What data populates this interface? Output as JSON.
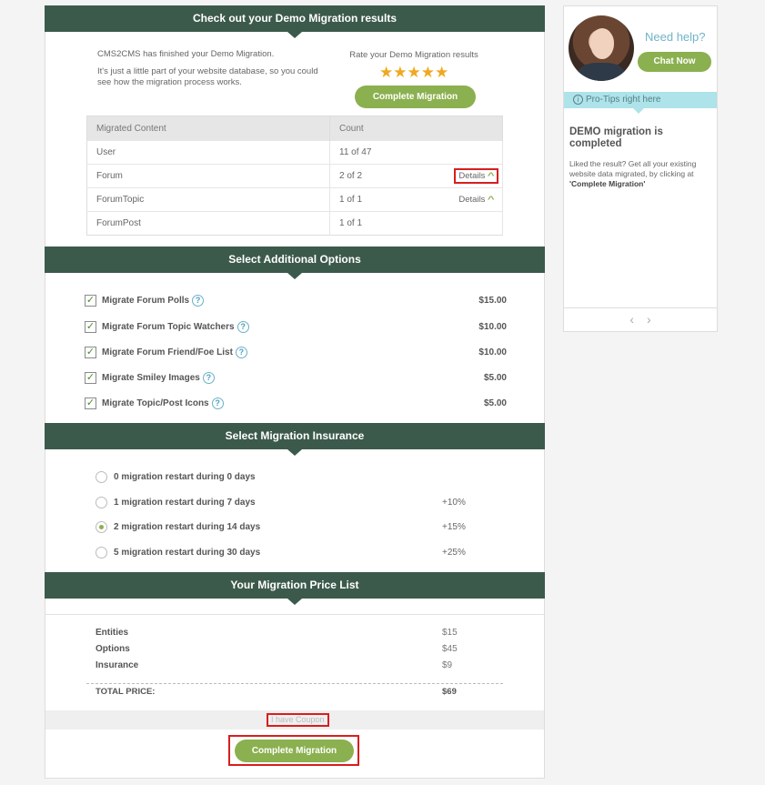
{
  "results": {
    "header": "Check out your Demo Migration results",
    "intro_line1": "CMS2CMS has finished your Demo Migration.",
    "intro_line2": "It's just a little part of your website database, so you could see how the migration process works.",
    "rate_label": "Rate your Demo Migration results",
    "stars": "★★★★★",
    "complete_button": "Complete Migration",
    "table": {
      "col_content": "Migrated Content",
      "col_count": "Count",
      "details_label": "Details",
      "rows": [
        {
          "content": "User",
          "count": "11 of 47"
        },
        {
          "content": "Forum",
          "count": "2 of 2"
        },
        {
          "content": "ForumTopic",
          "count": "1 of 1"
        },
        {
          "content": "ForumPost",
          "count": "1 of 1"
        }
      ]
    }
  },
  "options": {
    "header": "Select Additional Options",
    "items": [
      {
        "label": "Migrate Forum Polls",
        "price": "$15.00",
        "checked": true
      },
      {
        "label": "Migrate Forum Topic Watchers",
        "price": "$10.00",
        "checked": true
      },
      {
        "label": "Migrate Forum Friend/Foe List",
        "price": "$10.00",
        "checked": true
      },
      {
        "label": "Migrate Smiley Images",
        "price": "$5.00",
        "checked": true
      },
      {
        "label": "Migrate Topic/Post Icons",
        "price": "$5.00",
        "checked": true
      }
    ]
  },
  "insurance": {
    "header": "Select Migration Insurance",
    "items": [
      {
        "label": "0 migration restart during 0 days",
        "pct": "",
        "selected": false
      },
      {
        "label": "1 migration restart during 7 days",
        "pct": "+10%",
        "selected": false
      },
      {
        "label": "2 migration restart during 14 days",
        "pct": "+15%",
        "selected": true
      },
      {
        "label": "5 migration restart during 30 days",
        "pct": "+25%",
        "selected": false
      }
    ]
  },
  "price_list": {
    "header": "Your Migration Price List",
    "rows": [
      {
        "key": "Entities",
        "value": "$15"
      },
      {
        "key": "Options",
        "value": "$45"
      },
      {
        "key": "Insurance",
        "value": "$9"
      }
    ],
    "total_key": "TOTAL PRICE:",
    "total_value": "$69",
    "coupon_label": "I have Coupon",
    "complete_button": "Complete Migration"
  },
  "sidebar": {
    "need_help": "Need help?",
    "chat_button": "Chat Now",
    "protips_label": "Pro-Tips right here",
    "tip_title": "DEMO migration is completed",
    "tip_text_plain": "Liked the result? Get all your existing website data migrated, by clicking at ",
    "tip_text_bold": "'Complete Migration'",
    "prev_glyph": "‹",
    "next_glyph": "›"
  },
  "colors": {
    "header_bg": "#3c5a4b",
    "accent_green": "#8bb04f",
    "star": "#f0a820",
    "highlight_red": "#d81e1e",
    "protips_bg": "#aee3ea"
  },
  "icons": [
    "star-icon",
    "chevron-up-icon",
    "checkbox-checked-icon",
    "help-icon",
    "radio-icon",
    "info-icon",
    "chevron-left-icon",
    "chevron-right-icon"
  ]
}
